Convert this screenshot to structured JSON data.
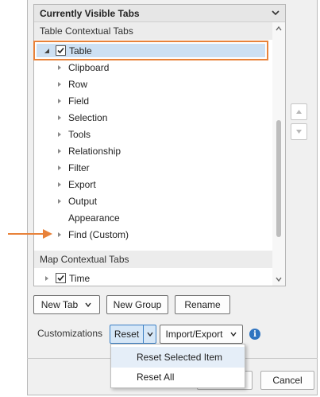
{
  "tree_panel": {
    "header": "Currently Visible Tabs",
    "table_section": "Table Contextual Tabs",
    "table_root": "Table",
    "table_children": [
      "Clipboard",
      "Row",
      "Field",
      "Selection",
      "Tools",
      "Relationship",
      "Filter",
      "Export",
      "Output"
    ],
    "appearance": "Appearance",
    "custom_item": "Find (Custom)",
    "map_section": "Map Contextual Tabs",
    "map_root": "Time"
  },
  "buttons": {
    "new_tab": "New Tab",
    "new_group": "New Group",
    "rename": "Rename",
    "customizations_label": "Customizations",
    "reset": "Reset",
    "import_export": "Import/Export",
    "cancel": "Cancel"
  },
  "reset_menu": {
    "items": [
      "Reset Selected Item",
      "Reset All"
    ]
  },
  "colors": {
    "highlight_border": "#e8823a",
    "selection_fill": "#cde0f3",
    "accent_blue": "#2f74c0",
    "arrow": "#e8823a"
  }
}
